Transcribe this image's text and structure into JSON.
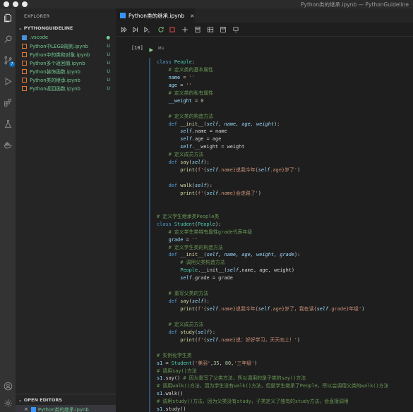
{
  "window": {
    "title": "Python类的继承.ipynb — PythonGuideline"
  },
  "sidebar": {
    "title": "EXPLORER",
    "section": "PYTHONGUIDELINE",
    "files": [
      {
        "name": ".vscode",
        "status": "●",
        "type": "folder"
      },
      {
        "name": "Python中LEGB规则.ipynb",
        "status": "U",
        "type": "notebook"
      },
      {
        "name": "Python中的类和对象.ipynb",
        "status": "U",
        "type": "notebook"
      },
      {
        "name": "Python多个返回值.ipynb",
        "status": "U",
        "type": "notebook"
      },
      {
        "name": "Python装饰函数.ipynb",
        "status": "U",
        "type": "notebook"
      },
      {
        "name": "Python类的继承.ipynb",
        "status": "U",
        "type": "notebook"
      },
      {
        "name": "Python返回函数.ipynb",
        "status": "U",
        "type": "notebook"
      }
    ],
    "open_editors_title": "OPEN EDITORS",
    "open_editors": [
      {
        "close": "×",
        "name": "Python类的继承.ipynb"
      }
    ]
  },
  "activity": {
    "source_control_badge": "7"
  },
  "editor": {
    "tab": {
      "label": "Python类的继承.ipynb",
      "close": "×"
    },
    "cell": {
      "exec_count": "[10]",
      "md_label": "M↓"
    },
    "code_lines": [
      [
        [
          "kd",
          "class "
        ],
        [
          "cls",
          "People"
        ],
        [
          "",
          ":"
        ]
      ],
      [
        [
          "cmt",
          "    # 定义类的基本属性"
        ]
      ],
      [
        [
          "var",
          "    name"
        ],
        [
          "",
          " = "
        ],
        [
          "str",
          "''"
        ]
      ],
      [
        [
          "var",
          "    age"
        ],
        [
          "",
          " = "
        ],
        [
          "str",
          "''"
        ]
      ],
      [
        [
          "cmt",
          "    # 定义类的私有属性"
        ]
      ],
      [
        [
          "var",
          "    __weight"
        ],
        [
          "",
          " = "
        ],
        [
          "num",
          "0"
        ]
      ],
      [
        [
          "",
          ""
        ]
      ],
      [
        [
          "cmt",
          "    # 定义类的构造方法"
        ]
      ],
      [
        [
          "kd",
          "    def "
        ],
        [
          "fn",
          "__init__"
        ],
        [
          "",
          "("
        ],
        [
          "self",
          "self, name, age, weight"
        ],
        [
          "",
          "):"
        ]
      ],
      [
        [
          "self",
          "        self"
        ],
        [
          "",
          ".name = name"
        ]
      ],
      [
        [
          "self",
          "        self"
        ],
        [
          "",
          ".age = age"
        ]
      ],
      [
        [
          "self",
          "        self"
        ],
        [
          "",
          ".__weight = weight"
        ]
      ],
      [
        [
          "cmt",
          "    # 定义成员方法"
        ]
      ],
      [
        [
          "kd",
          "    def "
        ],
        [
          "fn",
          "say"
        ],
        [
          "",
          "("
        ],
        [
          "self",
          "self"
        ],
        [
          "",
          "):"
        ]
      ],
      [
        [
          "fn",
          "        print"
        ],
        [
          "",
          "("
        ],
        [
          "str",
          "f'{"
        ],
        [
          "self",
          "self"
        ],
        [
          "str",
          ".name}说我今年{"
        ],
        [
          "self",
          "self"
        ],
        [
          "str",
          ".age}岁了'"
        ],
        [
          "",
          ")"
        ]
      ],
      [
        [
          "",
          ""
        ]
      ],
      [
        [
          "kd",
          "    def "
        ],
        [
          "fn",
          "walk"
        ],
        [
          "",
          "("
        ],
        [
          "self",
          "self"
        ],
        [
          "",
          "):"
        ]
      ],
      [
        [
          "fn",
          "        print"
        ],
        [
          "",
          "("
        ],
        [
          "str",
          "f'{"
        ],
        [
          "self",
          "self"
        ],
        [
          "str",
          ".name}会走路了'"
        ],
        [
          "",
          ")"
        ]
      ],
      [
        [
          "",
          ""
        ]
      ],
      [
        [
          "",
          ""
        ]
      ],
      [
        [
          "cmt",
          "# 定义学生继承类People类"
        ]
      ],
      [
        [
          "kd",
          "class "
        ],
        [
          "cls",
          "Student"
        ],
        [
          "",
          "("
        ],
        [
          "cls",
          "People"
        ],
        [
          "",
          "):"
        ]
      ],
      [
        [
          "cmt",
          "    # 定义学生类特有属性grade代表年级"
        ]
      ],
      [
        [
          "var",
          "    grade"
        ],
        [
          "",
          " = "
        ],
        [
          "str",
          "''"
        ]
      ],
      [
        [
          "cmt",
          "    # 定义学生类的构造方法"
        ]
      ],
      [
        [
          "kd",
          "    def "
        ],
        [
          "fn",
          "__init__"
        ],
        [
          "",
          "("
        ],
        [
          "self",
          "self, name, age, weight, grade"
        ],
        [
          "",
          "):"
        ]
      ],
      [
        [
          "cmt",
          "        # 调用父类构造方法"
        ]
      ],
      [
        [
          "cls",
          "        People"
        ],
        [
          "",
          ".__init__("
        ],
        [
          "self",
          "self"
        ],
        [
          "",
          ",name, age, weight)"
        ]
      ],
      [
        [
          "self",
          "        self"
        ],
        [
          "",
          ".grade = grade"
        ]
      ],
      [
        [
          "",
          ""
        ]
      ],
      [
        [
          "cmt",
          "    # 重写父类的方法"
        ]
      ],
      [
        [
          "kd",
          "    def "
        ],
        [
          "fn",
          "say"
        ],
        [
          "",
          "("
        ],
        [
          "self",
          "self"
        ],
        [
          "",
          "):"
        ]
      ],
      [
        [
          "fn",
          "        print"
        ],
        [
          "",
          "("
        ],
        [
          "str",
          "f'{"
        ],
        [
          "self",
          "self"
        ],
        [
          "str",
          ".name}说我今年{"
        ],
        [
          "self",
          "self"
        ],
        [
          "str",
          ".age}岁了，我在读{"
        ],
        [
          "self",
          "self"
        ],
        [
          "str",
          ".grade}年级'"
        ],
        [
          "",
          ")"
        ]
      ],
      [
        [
          "",
          ""
        ]
      ],
      [
        [
          "cmt",
          "    # 定义成员方法"
        ]
      ],
      [
        [
          "kd",
          "    def "
        ],
        [
          "fn",
          "study"
        ],
        [
          "",
          "("
        ],
        [
          "self",
          "self"
        ],
        [
          "",
          "):"
        ]
      ],
      [
        [
          "fn",
          "        print"
        ],
        [
          "",
          "("
        ],
        [
          "str",
          "f'{"
        ],
        [
          "self",
          "self"
        ],
        [
          "str",
          ".name}说：好好学习，天天向上！'"
        ],
        [
          "",
          ")"
        ]
      ],
      [
        [
          "",
          ""
        ]
      ],
      [
        [
          "cmt",
          "# 实例化学生类"
        ]
      ],
      [
        [
          "var",
          "s1"
        ],
        [
          "",
          " = "
        ],
        [
          "cls",
          "Student"
        ],
        [
          "",
          "("
        ],
        [
          "str",
          "'美羽'"
        ],
        [
          "",
          ","
        ],
        [
          "num",
          "35"
        ],
        [
          "",
          ", "
        ],
        [
          "num",
          "80"
        ],
        [
          "",
          ","
        ],
        [
          "str",
          "'三年级'"
        ],
        [
          "",
          ")"
        ]
      ],
      [
        [
          "cmt",
          "# 调用say()方法"
        ]
      ],
      [
        [
          "var",
          "s1"
        ],
        [
          "",
          ".say() "
        ],
        [
          "cmt",
          "# 因为重写了父类方法，所以调用的是子类的say()方法"
        ]
      ],
      [
        [
          "cmt",
          "# 调用walk()方法，因为学生没有walk()方法，但是学生继承了People，所以会调用父类的walk()方法"
        ]
      ],
      [
        [
          "var",
          "s1"
        ],
        [
          "",
          ".walk()"
        ]
      ],
      [
        [
          "cmt",
          "# 调用study()方法，因为父类没有study，子类定义了独有的study方法，会直接调用"
        ]
      ],
      [
        [
          "var",
          "s1"
        ],
        [
          "",
          ".study()"
        ]
      ]
    ]
  }
}
